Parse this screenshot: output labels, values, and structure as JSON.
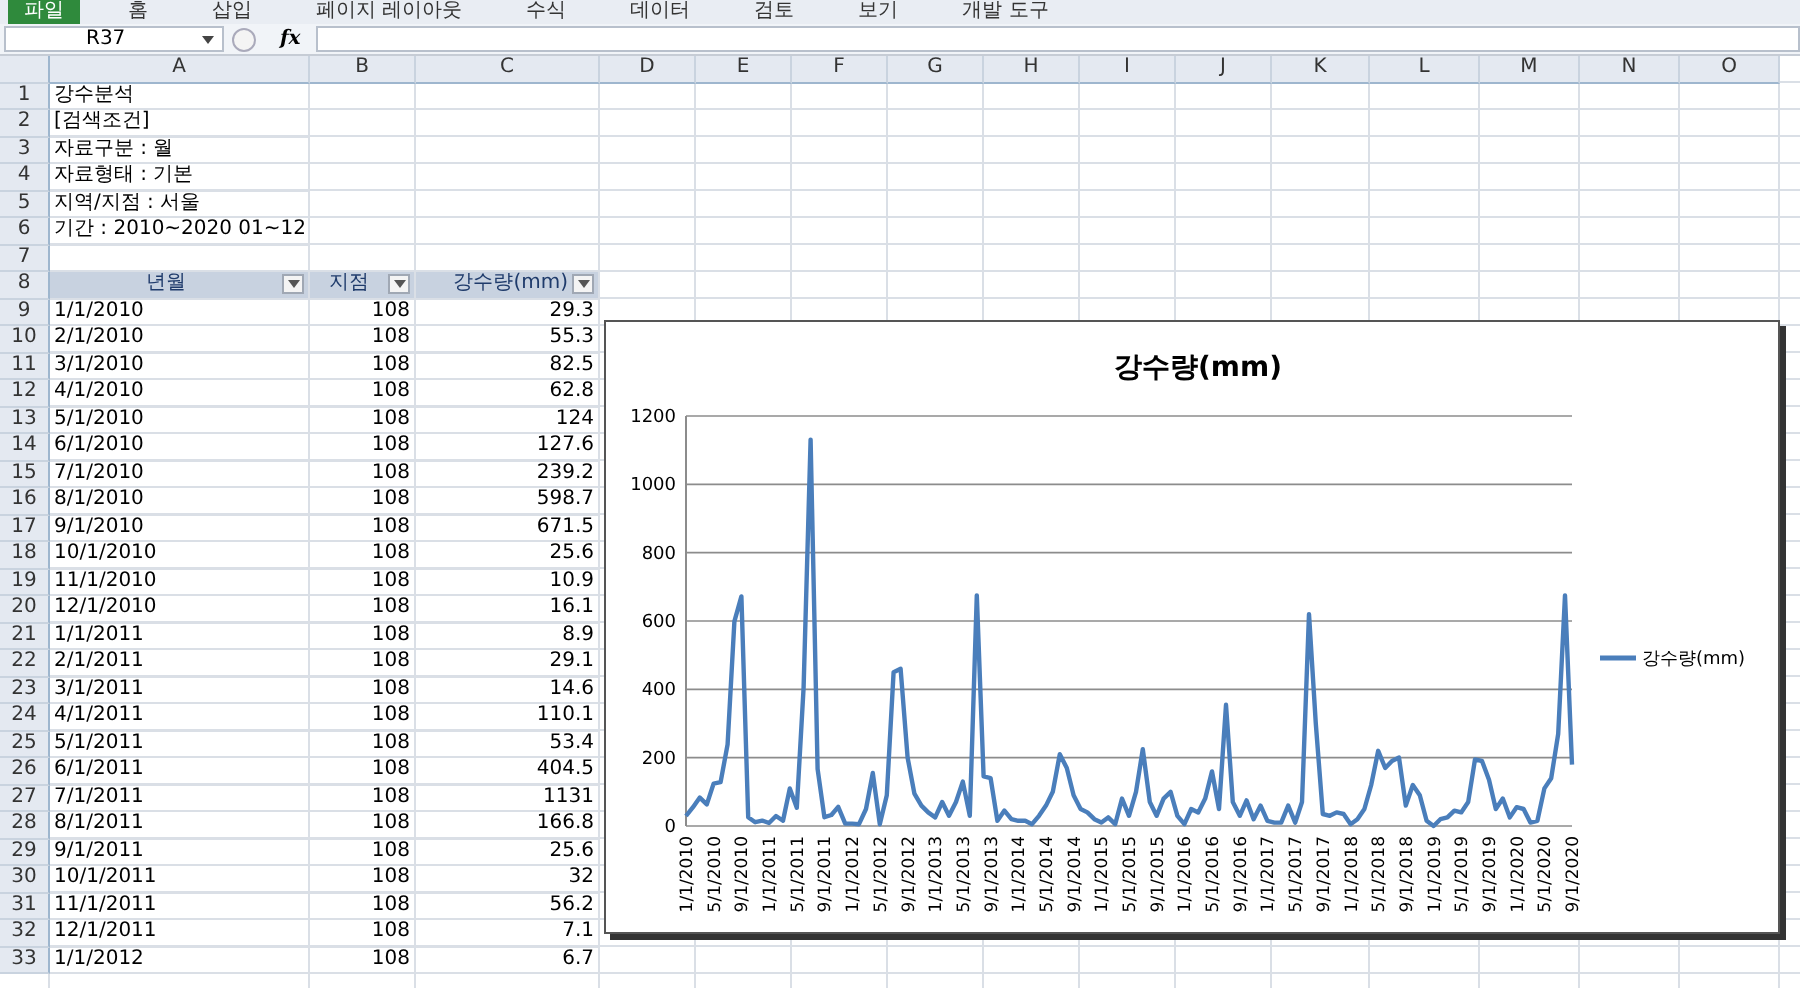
{
  "ribbon": {
    "tabs": [
      {
        "label": "파일",
        "selected": true
      },
      {
        "label": "홈",
        "selected": false
      },
      {
        "label": "삽입",
        "selected": false
      },
      {
        "label": "페이지 레이아웃",
        "selected": false
      },
      {
        "label": "수식",
        "selected": false
      },
      {
        "label": "데이터",
        "selected": false
      },
      {
        "label": "검토",
        "selected": false
      },
      {
        "label": "보기",
        "selected": false
      },
      {
        "label": "개발 도구",
        "selected": false
      }
    ]
  },
  "formula_bar": {
    "name_box": "R37",
    "function_label": "fx"
  },
  "sheet": {
    "columns": [
      "A",
      "B",
      "C",
      "D",
      "E",
      "F",
      "G",
      "H",
      "I",
      "J",
      "K",
      "L",
      "M",
      "N",
      "O"
    ],
    "rows": [
      {
        "row": "1",
        "kind": "text",
        "cells": [
          "강수분석"
        ]
      },
      {
        "row": "2",
        "kind": "text",
        "cells": [
          "[검색조건]"
        ]
      },
      {
        "row": "3",
        "kind": "text",
        "cells": [
          "자료구분 : 월"
        ]
      },
      {
        "row": "4",
        "kind": "text",
        "cells": [
          "자료형태 : 기본"
        ]
      },
      {
        "row": "5",
        "kind": "text",
        "cells": [
          "지역/지점 : 서울"
        ]
      },
      {
        "row": "6",
        "kind": "text",
        "cells": [
          "기간 : 2010~2020 01~12"
        ]
      },
      {
        "row": "7",
        "kind": "blank",
        "cells": []
      },
      {
        "row": "8",
        "kind": "header",
        "cells": [
          "년월",
          "지점",
          "강수량(mm)"
        ]
      },
      {
        "row": "9",
        "kind": "data",
        "cells": [
          "1/1/2010",
          "108",
          "29.3"
        ]
      },
      {
        "row": "10",
        "kind": "data",
        "cells": [
          "2/1/2010",
          "108",
          "55.3"
        ]
      },
      {
        "row": "11",
        "kind": "data",
        "cells": [
          "3/1/2010",
          "108",
          "82.5"
        ]
      },
      {
        "row": "12",
        "kind": "data",
        "cells": [
          "4/1/2010",
          "108",
          "62.8"
        ]
      },
      {
        "row": "13",
        "kind": "data",
        "cells": [
          "5/1/2010",
          "108",
          "124"
        ]
      },
      {
        "row": "14",
        "kind": "data",
        "cells": [
          "6/1/2010",
          "108",
          "127.6"
        ]
      },
      {
        "row": "15",
        "kind": "data",
        "cells": [
          "7/1/2010",
          "108",
          "239.2"
        ]
      },
      {
        "row": "16",
        "kind": "data",
        "cells": [
          "8/1/2010",
          "108",
          "598.7"
        ]
      },
      {
        "row": "17",
        "kind": "data",
        "cells": [
          "9/1/2010",
          "108",
          "671.5"
        ]
      },
      {
        "row": "18",
        "kind": "data",
        "cells": [
          "10/1/2010",
          "108",
          "25.6"
        ]
      },
      {
        "row": "19",
        "kind": "data",
        "cells": [
          "11/1/2010",
          "108",
          "10.9"
        ]
      },
      {
        "row": "20",
        "kind": "data",
        "cells": [
          "12/1/2010",
          "108",
          "16.1"
        ]
      },
      {
        "row": "21",
        "kind": "data",
        "cells": [
          "1/1/2011",
          "108",
          "8.9"
        ]
      },
      {
        "row": "22",
        "kind": "data",
        "cells": [
          "2/1/2011",
          "108",
          "29.1"
        ]
      },
      {
        "row": "23",
        "kind": "data",
        "cells": [
          "3/1/2011",
          "108",
          "14.6"
        ]
      },
      {
        "row": "24",
        "kind": "data",
        "cells": [
          "4/1/2011",
          "108",
          "110.1"
        ]
      },
      {
        "row": "25",
        "kind": "data",
        "cells": [
          "5/1/2011",
          "108",
          "53.4"
        ]
      },
      {
        "row": "26",
        "kind": "data",
        "cells": [
          "6/1/2011",
          "108",
          "404.5"
        ]
      },
      {
        "row": "27",
        "kind": "data",
        "cells": [
          "7/1/2011",
          "108",
          "1131"
        ]
      },
      {
        "row": "28",
        "kind": "data",
        "cells": [
          "8/1/2011",
          "108",
          "166.8"
        ]
      },
      {
        "row": "29",
        "kind": "data",
        "cells": [
          "9/1/2011",
          "108",
          "25.6"
        ]
      },
      {
        "row": "30",
        "kind": "data",
        "cells": [
          "10/1/2011",
          "108",
          "32"
        ]
      },
      {
        "row": "31",
        "kind": "data",
        "cells": [
          "11/1/2011",
          "108",
          "56.2"
        ]
      },
      {
        "row": "32",
        "kind": "data",
        "cells": [
          "12/1/2011",
          "108",
          "7.1"
        ]
      },
      {
        "row": "33",
        "kind": "data",
        "cells": [
          "1/1/2012",
          "108",
          "6.7"
        ]
      }
    ]
  },
  "chart": {
    "chart_data": {
      "type": "line",
      "title": "강수량(mm)",
      "categories": [
        "1/1/2010",
        null,
        null,
        null,
        "5/1/2010",
        null,
        null,
        null,
        "9/1/2010",
        null,
        null,
        null,
        "1/1/2011",
        null,
        null,
        null,
        "5/1/2011",
        null,
        null,
        null,
        "9/1/2011",
        null,
        null,
        null,
        "1/1/2012",
        null,
        null,
        null,
        "5/1/2012",
        null,
        null,
        null,
        "9/1/2012",
        null,
        null,
        null,
        "1/1/2013",
        null,
        null,
        null,
        "5/1/2013",
        null,
        null,
        null,
        "9/1/2013",
        null,
        null,
        null,
        "1/1/2014",
        null,
        null,
        null,
        "5/1/2014",
        null,
        null,
        null,
        "9/1/2014",
        null,
        null,
        null,
        "1/1/2015",
        null,
        null,
        null,
        "5/1/2015",
        null,
        null,
        null,
        "9/1/2015",
        null,
        null,
        null,
        "1/1/2016",
        null,
        null,
        null,
        "5/1/2016",
        null,
        null,
        null,
        "9/1/2016",
        null,
        null,
        null,
        "1/1/2017",
        null,
        null,
        null,
        "5/1/2017",
        null,
        null,
        null,
        "9/1/2017",
        null,
        null,
        null,
        "1/1/2018",
        null,
        null,
        null,
        "5/1/2018",
        null,
        null,
        null,
        "9/1/2018",
        null,
        null,
        null,
        "1/1/2019",
        null,
        null,
        null,
        "5/1/2019",
        null,
        null,
        null,
        "9/1/2019",
        null,
        null,
        null,
        "1/1/2020",
        null,
        null,
        null,
        "5/1/2020",
        null,
        null,
        null,
        "9/1/2020"
      ],
      "series": [
        {
          "name": "강수량(mm)",
          "color": "#4a7ebb",
          "values": [
            29,
            55,
            83,
            63,
            124,
            128,
            239,
            599,
            672,
            26,
            11,
            16,
            9,
            29,
            15,
            110,
            53,
            405,
            1131,
            167,
            26,
            32,
            56,
            7,
            7,
            5,
            50,
            155,
            5,
            90,
            450,
            460,
            200,
            95,
            60,
            40,
            25,
            70,
            30,
            70,
            130,
            30,
            675,
            145,
            140,
            15,
            45,
            20,
            15,
            15,
            5,
            30,
            60,
            100,
            210,
            170,
            90,
            50,
            40,
            20,
            10,
            25,
            5,
            80,
            30,
            100,
            225,
            70,
            30,
            80,
            100,
            30,
            5,
            50,
            40,
            80,
            160,
            50,
            355,
            70,
            30,
            75,
            20,
            60,
            15,
            10,
            10,
            60,
            10,
            70,
            620,
            300,
            35,
            30,
            40,
            35,
            5,
            20,
            50,
            120,
            220,
            170,
            190,
            200,
            60,
            120,
            90,
            15,
            0,
            20,
            25,
            45,
            40,
            70,
            195,
            190,
            135,
            50,
            80,
            25,
            55,
            50,
            10,
            15,
            110,
            140,
            270,
            675,
            180
          ]
        }
      ],
      "ylim": [
        0,
        1200
      ],
      "grid": true,
      "yticks": [
        0,
        200,
        400,
        600,
        800,
        1000,
        1200
      ]
    }
  }
}
